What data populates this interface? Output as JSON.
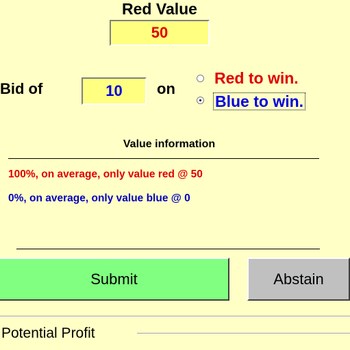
{
  "header": {
    "title": "Red Value",
    "red_value": "50"
  },
  "bid": {
    "label": "Bid of",
    "amount": "10",
    "on_label": "on",
    "options": [
      {
        "label": "Red to win.",
        "selected": false,
        "color": "#E00000"
      },
      {
        "label": "Blue to win.",
        "selected": true,
        "color": "#0000E0"
      }
    ]
  },
  "value_info": {
    "title": "Value information",
    "red_line": "100%, on average, only value red @ 50",
    "blue_line": "0%, on average, only value blue @ 0"
  },
  "actions": {
    "submit_label": "Submit",
    "abstain_label": "Abstain",
    "submit_color": "#80FF80",
    "abstain_color": "#C0C0C0"
  },
  "profit": {
    "label": "Potential Profit"
  },
  "colors": {
    "background": "#FFFFC6",
    "input_background": "#FFFF80",
    "red": "#E00000",
    "blue": "#0000E0"
  }
}
